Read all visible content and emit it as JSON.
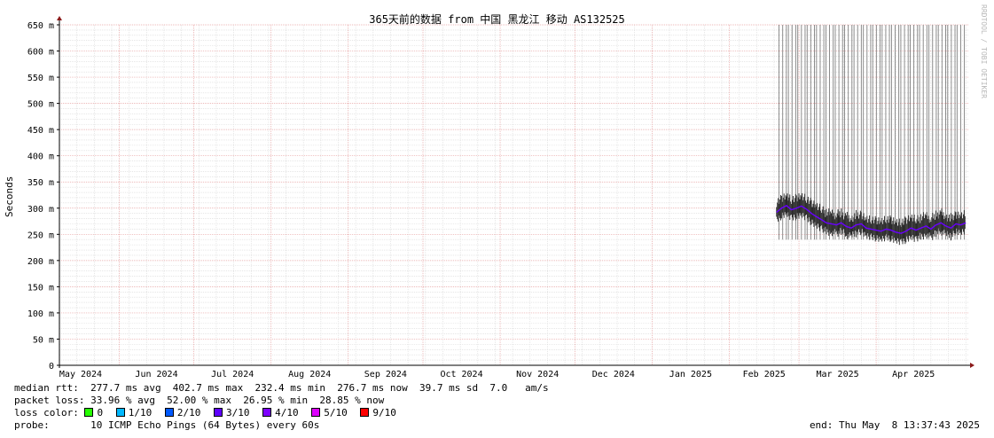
{
  "chart_data": {
    "type": "line",
    "title": "365天前的数据 from 中国 黑龙江 移动 AS132525",
    "ylabel": "Seconds",
    "ylim": [
      0,
      650
    ],
    "y_ticks": [
      {
        "value": 0,
        "label": "0"
      },
      {
        "value": 50,
        "label": "50 m"
      },
      {
        "value": 100,
        "label": "100 m"
      },
      {
        "value": 150,
        "label": "150 m"
      },
      {
        "value": 200,
        "label": "200 m"
      },
      {
        "value": 250,
        "label": "250 m"
      },
      {
        "value": 300,
        "label": "300 m"
      },
      {
        "value": 350,
        "label": "350 m"
      },
      {
        "value": 400,
        "label": "400 m"
      },
      {
        "value": 450,
        "label": "450 m"
      },
      {
        "value": 500,
        "label": "500 m"
      },
      {
        "value": 550,
        "label": "550 m"
      },
      {
        "value": 600,
        "label": "600 m"
      },
      {
        "value": 650,
        "label": "650 m"
      }
    ],
    "x_range": [
      "2024-05-08",
      "2025-05-08"
    ],
    "x_ticks": [
      {
        "label": "May 2024",
        "date": "2024-05-01"
      },
      {
        "label": "Jun 2024",
        "date": "2024-06-01"
      },
      {
        "label": "Jul 2024",
        "date": "2024-07-01"
      },
      {
        "label": "Aug 2024",
        "date": "2024-08-01"
      },
      {
        "label": "Sep 2024",
        "date": "2024-09-01"
      },
      {
        "label": "Oct 2024",
        "date": "2024-10-01"
      },
      {
        "label": "Nov 2024",
        "date": "2024-11-01"
      },
      {
        "label": "Dec 2024",
        "date": "2024-12-01"
      },
      {
        "label": "Jan 2025",
        "date": "2025-01-01"
      },
      {
        "label": "Feb 2025",
        "date": "2025-02-01"
      },
      {
        "label": "Mar 2025",
        "date": "2025-03-01"
      },
      {
        "label": "Apr 2025",
        "date": "2025-04-01"
      }
    ],
    "grid": true,
    "series": [
      {
        "color": "#6a00ff",
        "x": [
          "2025-02-20",
          "2025-02-22",
          "2025-02-24",
          "2025-02-26",
          "2025-02-28",
          "2025-03-02",
          "2025-03-04",
          "2025-03-06",
          "2025-03-08",
          "2025-03-10",
          "2025-03-12",
          "2025-03-14",
          "2025-03-16",
          "2025-03-18",
          "2025-03-20",
          "2025-03-22",
          "2025-03-24",
          "2025-03-26",
          "2025-03-28",
          "2025-03-30",
          "2025-04-01",
          "2025-04-03",
          "2025-04-05",
          "2025-04-07",
          "2025-04-09",
          "2025-04-11",
          "2025-04-13",
          "2025-04-15",
          "2025-04-17",
          "2025-04-19",
          "2025-04-21",
          "2025-04-23",
          "2025-04-25",
          "2025-04-27",
          "2025-04-29",
          "2025-05-01",
          "2025-05-03",
          "2025-05-05",
          "2025-05-07"
        ],
        "y": [
          292,
          300,
          305,
          297,
          300,
          304,
          298,
          290,
          284,
          278,
          272,
          270,
          268,
          272,
          265,
          262,
          268,
          270,
          262,
          260,
          258,
          256,
          260,
          258,
          254,
          252,
          256,
          262,
          258,
          262,
          266,
          260,
          268,
          272,
          266,
          262,
          270,
          268,
          272
        ]
      }
    ],
    "loss_spikes": {
      "color": "#808080",
      "top": 650,
      "x_range": [
        "2025-02-21",
        "2025-05-06"
      ],
      "count": 60
    },
    "legend": {
      "median_rtt": "median rtt:  277.7 ms avg  402.7 ms max  232.4 ms min  276.7 ms now  39.7 ms sd  7.0   am/s",
      "packet_loss": "packet loss: 33.96 % avg  52.00 % max  26.95 % min  28.85 % now",
      "loss_color_label": "loss color:",
      "loss_colors": [
        {
          "label": "0",
          "color": "#26ff00"
        },
        {
          "label": "1/10",
          "color": "#00b8ff"
        },
        {
          "label": "2/10",
          "color": "#0059ff"
        },
        {
          "label": "3/10",
          "color": "#5e00ff"
        },
        {
          "label": "4/10",
          "color": "#7e00ff"
        },
        {
          "label": "5/10",
          "color": "#dd00ff"
        },
        {
          "label": "9/10",
          "color": "#ff0000"
        }
      ],
      "probe": "probe:       10 ICMP Echo Pings (64 Bytes) every 60s",
      "end": "end: Thu May  8 13:37:43 2025"
    },
    "watermark": "RRDTOOL / TOBI OETIKER"
  }
}
